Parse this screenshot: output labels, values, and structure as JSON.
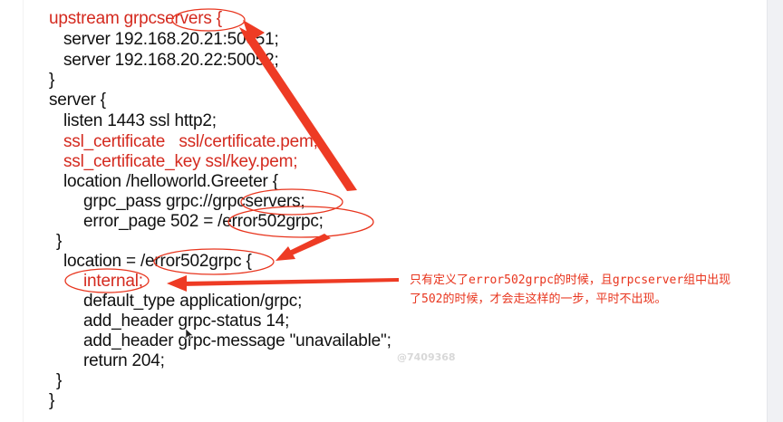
{
  "code": {
    "l01": "upstream grpcservers {",
    "l02": "server 192.168.20.21:50051;",
    "l03": "server 192.168.20.22:50052;",
    "l04": "}",
    "l05": "server {",
    "l06": "listen 1443 ssl http2;",
    "l07": "ssl_certificate   ssl/certificate.pem;",
    "l08": "ssl_certificate_key ssl/key.pem;",
    "l09": "location /helloworld.Greeter {",
    "l10": "grpc_pass grpc://grpcservers;",
    "l11": "error_page 502 = /error502grpc;",
    "l12": "}",
    "l13": "location = /error502grpc {",
    "l14": "internal;",
    "l15": "default_type application/grpc;",
    "l16": "add_header grpc-status 14;",
    "l17": "add_header grpc-message \"unavailable\";",
    "l18": "return 204;",
    "l19": "}",
    "l20": "}"
  },
  "note": {
    "line1": "只有定义了error502grpc的时候，且grpcserver组中出现",
    "line2": "了502的时候，才会走这样的一步，平时不出现。"
  },
  "watermark": "@7409368",
  "colors": {
    "code_text": "#111111",
    "code_red": "#d42a1f",
    "annotation_red": "#e8351e",
    "background": "#ffffff"
  }
}
